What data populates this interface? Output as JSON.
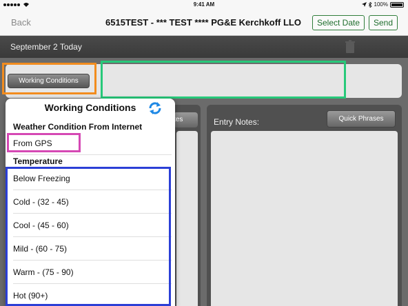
{
  "status": {
    "time": "9:41 AM",
    "battery": "100%"
  },
  "nav": {
    "back": "Back",
    "title": "6515TEST - *** TEST **** PG&E Kerchkoff LLO",
    "select_date": "Select Date",
    "send": "Send"
  },
  "datebar": {
    "label": "September 2 Today"
  },
  "toolbar": {
    "working_conditions": "Working Conditions",
    "partial_button": "tes"
  },
  "notes": {
    "title": "Entry Notes:",
    "quick_phrases": "Quick Phrases"
  },
  "popover": {
    "title": "Working Conditions",
    "weather_section": "Weather Condition From Internet",
    "gps_option": "From GPS",
    "temperature_section": "Temperature",
    "temperature_options": [
      "Below Freezing",
      "Cold - (32 - 45)",
      "Cool - (45 - 60)",
      "Mild - (60 - 75)",
      "Warm - (75 - 90)",
      "Hot (90+)"
    ]
  },
  "colors": {
    "accent_green": "#1f6e2d",
    "highlight_orange": "#f28c1e",
    "highlight_green": "#27c97a",
    "highlight_pink": "#d548b4",
    "highlight_blue": "#2b3fd6",
    "refresh_blue": "#1e88e5"
  }
}
